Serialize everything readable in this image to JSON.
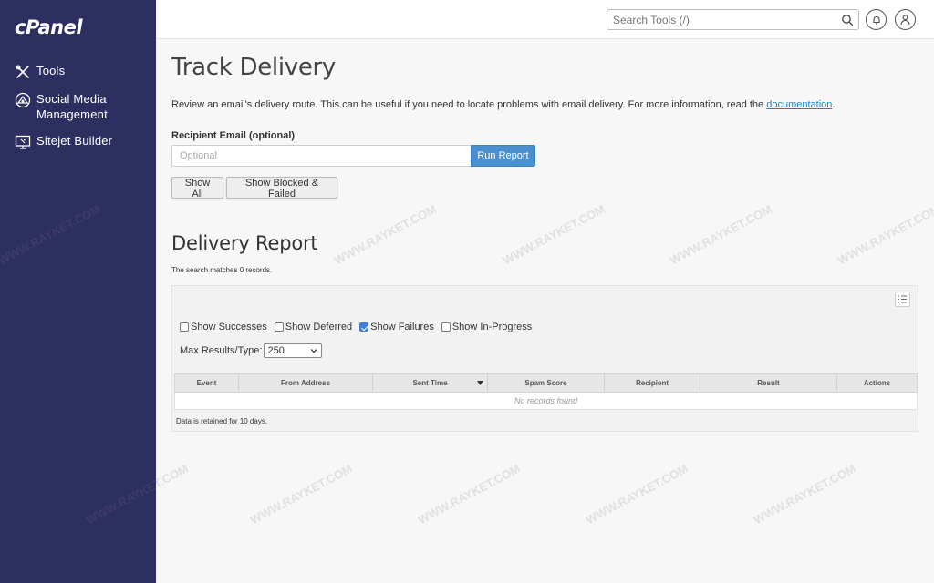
{
  "brand": {
    "logo_text": "cPanel"
  },
  "sidebar": {
    "items": [
      {
        "label": "Tools",
        "icon": "tools-icon"
      },
      {
        "label": "Social Media Management",
        "icon": "social-media-icon"
      },
      {
        "label": "Sitejet Builder",
        "icon": "sitejet-icon"
      }
    ]
  },
  "header": {
    "search_placeholder": "Search Tools (/)"
  },
  "page": {
    "title": "Track Delivery",
    "description": "Review an email's delivery route. This can be useful if you need to locate problems with email delivery. For more information, read the",
    "doc_link": "documentation",
    "recipient_label": "Recipient Email (optional)",
    "recipient_placeholder": "Optional",
    "run_report": "Run Report",
    "show_all": "Show All",
    "show_blocked": "Show Blocked & Failed"
  },
  "report": {
    "title": "Delivery Report",
    "subtitle": "The search matches 0 records.",
    "filters": [
      {
        "label": "Show Successes",
        "checked": false
      },
      {
        "label": "Show Deferred",
        "checked": false
      },
      {
        "label": "Show Failures",
        "checked": true
      },
      {
        "label": "Show In-Progress",
        "checked": false
      }
    ],
    "max_label": "Max Results/Type:",
    "max_value": "250",
    "columns": [
      "Event",
      "From Address",
      "Sent Time",
      "Spam Score",
      "Recipient",
      "Result",
      "Actions"
    ],
    "empty_text": "No records found",
    "retained_note": "Data is retained for 10 days."
  },
  "watermark": "WWW.RAYKET.COM",
  "colors": {
    "sidebar": "#2e2f61",
    "primary_button": "#4a90d0",
    "link": "#2b80b9"
  }
}
